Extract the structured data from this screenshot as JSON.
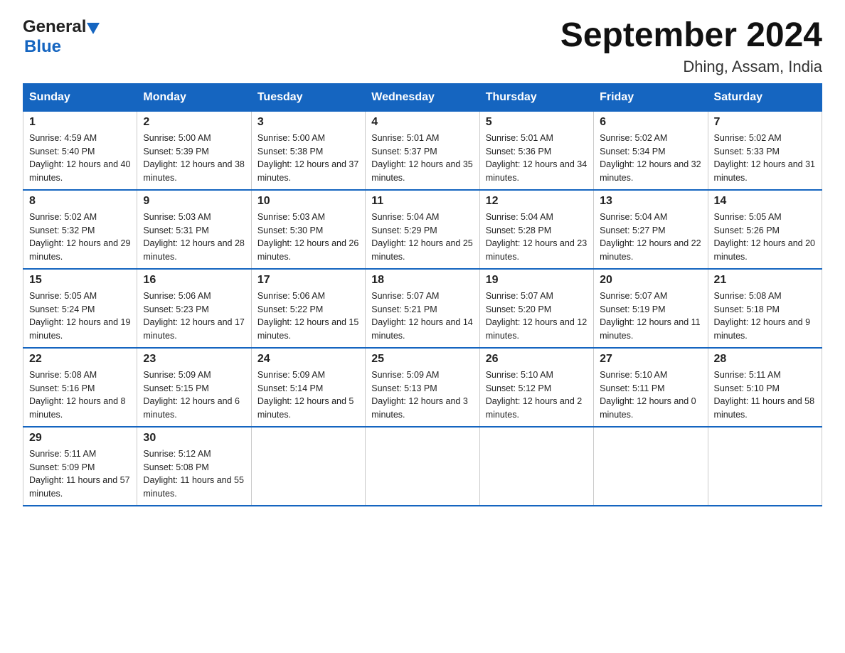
{
  "header": {
    "logo_general": "General",
    "logo_blue": "Blue",
    "title": "September 2024",
    "subtitle": "Dhing, Assam, India"
  },
  "weekdays": [
    "Sunday",
    "Monday",
    "Tuesday",
    "Wednesday",
    "Thursday",
    "Friday",
    "Saturday"
  ],
  "weeks": [
    [
      {
        "day": "1",
        "sunrise": "Sunrise: 4:59 AM",
        "sunset": "Sunset: 5:40 PM",
        "daylight": "Daylight: 12 hours and 40 minutes."
      },
      {
        "day": "2",
        "sunrise": "Sunrise: 5:00 AM",
        "sunset": "Sunset: 5:39 PM",
        "daylight": "Daylight: 12 hours and 38 minutes."
      },
      {
        "day": "3",
        "sunrise": "Sunrise: 5:00 AM",
        "sunset": "Sunset: 5:38 PM",
        "daylight": "Daylight: 12 hours and 37 minutes."
      },
      {
        "day": "4",
        "sunrise": "Sunrise: 5:01 AM",
        "sunset": "Sunset: 5:37 PM",
        "daylight": "Daylight: 12 hours and 35 minutes."
      },
      {
        "day": "5",
        "sunrise": "Sunrise: 5:01 AM",
        "sunset": "Sunset: 5:36 PM",
        "daylight": "Daylight: 12 hours and 34 minutes."
      },
      {
        "day": "6",
        "sunrise": "Sunrise: 5:02 AM",
        "sunset": "Sunset: 5:34 PM",
        "daylight": "Daylight: 12 hours and 32 minutes."
      },
      {
        "day": "7",
        "sunrise": "Sunrise: 5:02 AM",
        "sunset": "Sunset: 5:33 PM",
        "daylight": "Daylight: 12 hours and 31 minutes."
      }
    ],
    [
      {
        "day": "8",
        "sunrise": "Sunrise: 5:02 AM",
        "sunset": "Sunset: 5:32 PM",
        "daylight": "Daylight: 12 hours and 29 minutes."
      },
      {
        "day": "9",
        "sunrise": "Sunrise: 5:03 AM",
        "sunset": "Sunset: 5:31 PM",
        "daylight": "Daylight: 12 hours and 28 minutes."
      },
      {
        "day": "10",
        "sunrise": "Sunrise: 5:03 AM",
        "sunset": "Sunset: 5:30 PM",
        "daylight": "Daylight: 12 hours and 26 minutes."
      },
      {
        "day": "11",
        "sunrise": "Sunrise: 5:04 AM",
        "sunset": "Sunset: 5:29 PM",
        "daylight": "Daylight: 12 hours and 25 minutes."
      },
      {
        "day": "12",
        "sunrise": "Sunrise: 5:04 AM",
        "sunset": "Sunset: 5:28 PM",
        "daylight": "Daylight: 12 hours and 23 minutes."
      },
      {
        "day": "13",
        "sunrise": "Sunrise: 5:04 AM",
        "sunset": "Sunset: 5:27 PM",
        "daylight": "Daylight: 12 hours and 22 minutes."
      },
      {
        "day": "14",
        "sunrise": "Sunrise: 5:05 AM",
        "sunset": "Sunset: 5:26 PM",
        "daylight": "Daylight: 12 hours and 20 minutes."
      }
    ],
    [
      {
        "day": "15",
        "sunrise": "Sunrise: 5:05 AM",
        "sunset": "Sunset: 5:24 PM",
        "daylight": "Daylight: 12 hours and 19 minutes."
      },
      {
        "day": "16",
        "sunrise": "Sunrise: 5:06 AM",
        "sunset": "Sunset: 5:23 PM",
        "daylight": "Daylight: 12 hours and 17 minutes."
      },
      {
        "day": "17",
        "sunrise": "Sunrise: 5:06 AM",
        "sunset": "Sunset: 5:22 PM",
        "daylight": "Daylight: 12 hours and 15 minutes."
      },
      {
        "day": "18",
        "sunrise": "Sunrise: 5:07 AM",
        "sunset": "Sunset: 5:21 PM",
        "daylight": "Daylight: 12 hours and 14 minutes."
      },
      {
        "day": "19",
        "sunrise": "Sunrise: 5:07 AM",
        "sunset": "Sunset: 5:20 PM",
        "daylight": "Daylight: 12 hours and 12 minutes."
      },
      {
        "day": "20",
        "sunrise": "Sunrise: 5:07 AM",
        "sunset": "Sunset: 5:19 PM",
        "daylight": "Daylight: 12 hours and 11 minutes."
      },
      {
        "day": "21",
        "sunrise": "Sunrise: 5:08 AM",
        "sunset": "Sunset: 5:18 PM",
        "daylight": "Daylight: 12 hours and 9 minutes."
      }
    ],
    [
      {
        "day": "22",
        "sunrise": "Sunrise: 5:08 AM",
        "sunset": "Sunset: 5:16 PM",
        "daylight": "Daylight: 12 hours and 8 minutes."
      },
      {
        "day": "23",
        "sunrise": "Sunrise: 5:09 AM",
        "sunset": "Sunset: 5:15 PM",
        "daylight": "Daylight: 12 hours and 6 minutes."
      },
      {
        "day": "24",
        "sunrise": "Sunrise: 5:09 AM",
        "sunset": "Sunset: 5:14 PM",
        "daylight": "Daylight: 12 hours and 5 minutes."
      },
      {
        "day": "25",
        "sunrise": "Sunrise: 5:09 AM",
        "sunset": "Sunset: 5:13 PM",
        "daylight": "Daylight: 12 hours and 3 minutes."
      },
      {
        "day": "26",
        "sunrise": "Sunrise: 5:10 AM",
        "sunset": "Sunset: 5:12 PM",
        "daylight": "Daylight: 12 hours and 2 minutes."
      },
      {
        "day": "27",
        "sunrise": "Sunrise: 5:10 AM",
        "sunset": "Sunset: 5:11 PM",
        "daylight": "Daylight: 12 hours and 0 minutes."
      },
      {
        "day": "28",
        "sunrise": "Sunrise: 5:11 AM",
        "sunset": "Sunset: 5:10 PM",
        "daylight": "Daylight: 11 hours and 58 minutes."
      }
    ],
    [
      {
        "day": "29",
        "sunrise": "Sunrise: 5:11 AM",
        "sunset": "Sunset: 5:09 PM",
        "daylight": "Daylight: 11 hours and 57 minutes."
      },
      {
        "day": "30",
        "sunrise": "Sunrise: 5:12 AM",
        "sunset": "Sunset: 5:08 PM",
        "daylight": "Daylight: 11 hours and 55 minutes."
      },
      null,
      null,
      null,
      null,
      null
    ]
  ]
}
